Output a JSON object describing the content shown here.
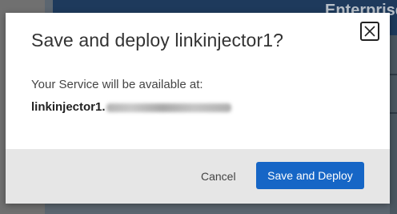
{
  "background": {
    "header_partial_text": "Enterprise SEO"
  },
  "dialog": {
    "title": "Save and deploy linkinjector1?",
    "close_icon": "close-icon",
    "availability_label": "Your Service will be available at:",
    "service_name": "linkinjector1.",
    "service_domain_redacted": true,
    "cancel_label": "Cancel",
    "confirm_label": "Save and Deploy"
  },
  "colors": {
    "primary_button": "#1666c6",
    "footer_background": "#e6e6e6",
    "overlay": "#6e6e6e"
  }
}
